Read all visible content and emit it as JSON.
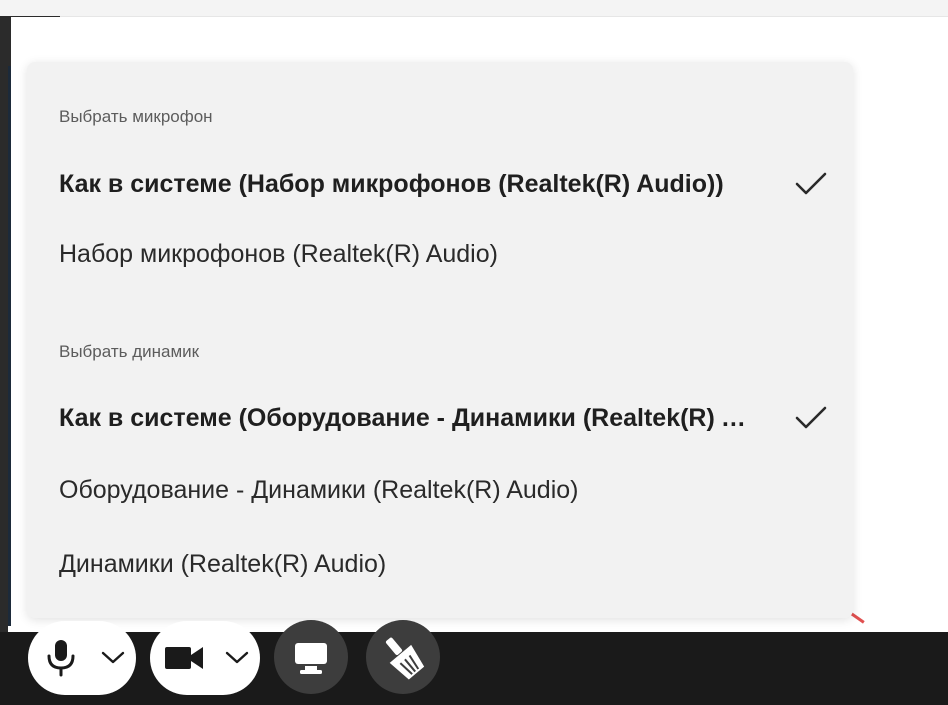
{
  "device_menu": {
    "microphone_title": "Выбрать микрофон",
    "microphones": [
      {
        "label": "Как в системе (Набор микрофонов (Realtek(R) Audio))",
        "selected": true
      },
      {
        "label": "Набор микрофонов (Realtek(R) Audio)",
        "selected": false
      }
    ],
    "speaker_title": "Выбрать динамик",
    "speakers": [
      {
        "label": "Как в системе (Оборудование - Динамики (Realtek(R) Audio))",
        "selected": true
      },
      {
        "label": "Оборудование - Динамики (Realtek(R) Audio)",
        "selected": false
      },
      {
        "label": "Динамики (Realtek(R) Audio)",
        "selected": false
      }
    ]
  },
  "toolbar": {
    "icons": [
      "microphone-icon",
      "chevron-down-icon",
      "camera-icon",
      "chevron-down-icon",
      "screen-share-icon",
      "clean-icon"
    ]
  },
  "colors": {
    "menu_bg": "#f2f2f2",
    "toolbar_bg": "#1a1a1a",
    "round_button_bg": "#3d3d3d"
  }
}
